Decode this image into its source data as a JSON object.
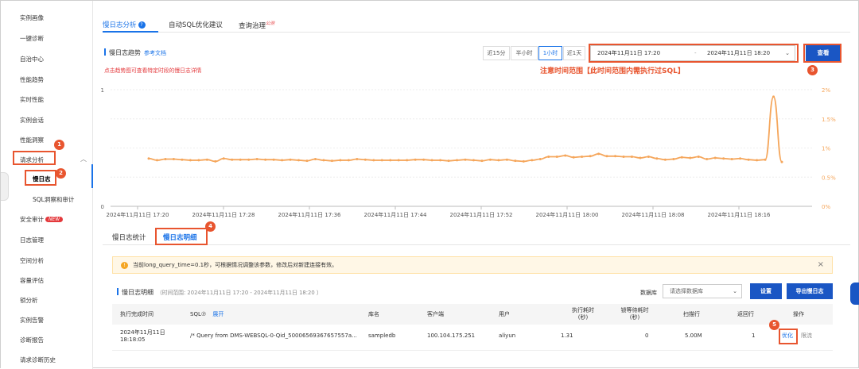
{
  "sidebar": {
    "items": [
      {
        "label": "实例画像"
      },
      {
        "label": "一键诊断"
      },
      {
        "label": "自治中心"
      },
      {
        "label": "性能趋势"
      },
      {
        "label": "实时性能"
      },
      {
        "label": "实例会话"
      },
      {
        "label": "性能洞察"
      },
      {
        "label": "请求分析"
      },
      {
        "label": "慢日志"
      },
      {
        "label": "SQL洞察和审计"
      },
      {
        "label": "安全审计"
      },
      {
        "label": "日志管理"
      },
      {
        "label": "空间分析"
      },
      {
        "label": "容量评估"
      },
      {
        "label": "锁分析"
      },
      {
        "label": "实例告警"
      },
      {
        "label": "诊断报告"
      },
      {
        "label": "请求诊断历史"
      }
    ],
    "new_badge": "NEW"
  },
  "markers": [
    "1",
    "2",
    "3",
    "4",
    "5"
  ],
  "tabs": {
    "slowlog": "慢日志分析",
    "help": "?",
    "autosql": "自动SQL优化建议",
    "governance": "查询治理",
    "governance_sup": "公测"
  },
  "trend": {
    "title": "慢日志趋势",
    "doc_link": "参考文档",
    "hint": "点击趋势图可查看特定时段的慢日志详情"
  },
  "time_buttons": {
    "m15": "近15分",
    "m30": "半小时",
    "h1": "1小时",
    "d1": "近1天"
  },
  "date_range": {
    "start": "2024年11月11日 17:20",
    "sep": "-",
    "end": "2024年11月11日 18:20"
  },
  "query_button": "查看",
  "annotation": "注意时间范围【此时间范围内需执行过SQL】",
  "chart_data": {
    "type": "line",
    "x_ticks": [
      "2024年11月11日 17:20",
      "2024年11月11日 17:28",
      "2024年11月11日 17:36",
      "2024年11月11日 17:44",
      "2024年11月11日 17:52",
      "2024年11月11日 18:00",
      "2024年11月11日 18:08",
      "2024年11月11日 18:16"
    ],
    "y_left_ticks": [
      "1",
      "0"
    ],
    "y_right_ticks": [
      "2%",
      "1.5%",
      "1%",
      "0.5%",
      "0%"
    ],
    "ylim_right": [
      0,
      2
    ],
    "series": [
      {
        "color": "#f5a65b",
        "values": [
          0.82,
          0.79,
          0.81,
          0.81,
          0.8,
          0.79,
          0.79,
          0.8,
          0.77,
          0.82,
          0.8,
          0.8,
          0.8,
          0.81,
          0.8,
          0.8,
          0.79,
          0.8,
          0.79,
          0.78,
          0.81,
          0.79,
          0.78,
          0.79,
          0.79,
          0.81,
          0.8,
          0.79,
          0.79,
          0.79,
          0.79,
          0.79,
          0.8,
          0.8,
          0.79,
          0.79,
          0.78,
          0.79,
          0.8,
          0.79,
          0.78,
          0.8,
          0.79,
          0.8,
          0.78,
          0.77,
          0.79,
          0.81,
          0.85,
          0.85,
          0.87,
          0.84,
          0.85,
          0.86,
          0.9,
          0.86,
          0.86,
          0.85,
          0.85,
          0.83,
          0.85,
          0.82,
          0.8,
          0.81,
          0.84,
          0.83,
          0.85,
          0.81,
          0.83,
          0.82,
          0.81,
          0.82,
          0.8,
          0.79,
          0.8,
          1.88,
          0.76
        ]
      }
    ]
  },
  "subtabs": {
    "stats": "慢日志统计",
    "detail": "慢日志明细"
  },
  "notice": {
    "text": "当前long_query_time=0.1秒，可根据情况调整该参数，修改后对新建连接有效。",
    "close": "×"
  },
  "detail": {
    "title": "慢日志明细",
    "range": "（时间范围: 2024年11月11日 17:20 - 2024年11月11日 18:20 ）",
    "db_label": "数据库",
    "db_placeholder": "请选择数据库",
    "settings": "设置",
    "export": "导出慢日志"
  },
  "table": {
    "headers": {
      "time": "执行完成时间",
      "sql": "SQL⑦",
      "expand": "展开",
      "db": "库名",
      "client": "客户端",
      "user": "用户",
      "exec_time": [
        "执行耗时",
        "(秒)"
      ],
      "lock_time": [
        "锁等待耗时",
        "(秒)"
      ],
      "scanned": "扫描行",
      "returned": "返回行",
      "ops": "操作"
    },
    "rows": [
      {
        "time": [
          "2024年11月11日",
          "18:18:05"
        ],
        "sql": "/* Query from DMS-WEBSQL-0-Qid_50006569367657557a...",
        "db": "sampledb",
        "client": "100.104.175.251",
        "user": "aliyun",
        "exec_time": "1.31",
        "lock_time": "0",
        "scanned": "5.00M",
        "returned": "1",
        "optimize": "优化",
        "throttle": "限流"
      }
    ]
  }
}
